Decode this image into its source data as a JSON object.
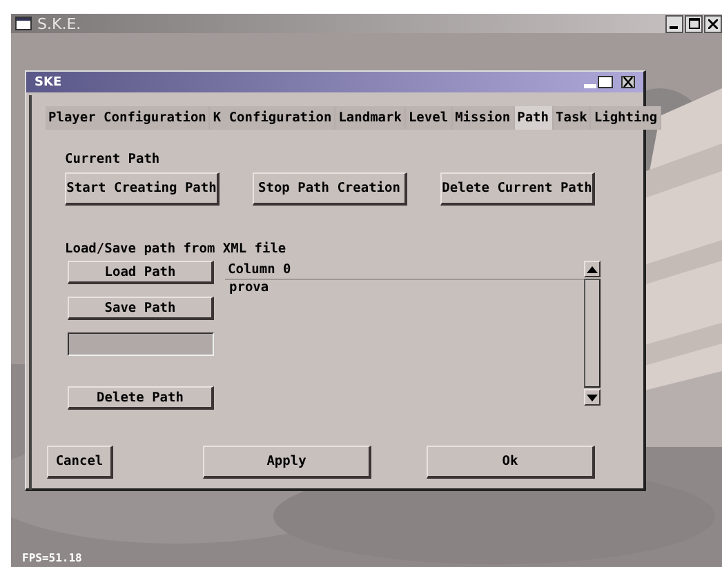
{
  "window": {
    "title": "S.K.E."
  },
  "dialog": {
    "title": "SKE",
    "tabs": [
      {
        "label": "Player Configuration",
        "selected": false
      },
      {
        "label": "K Configuration",
        "selected": false
      },
      {
        "label": "Landmark",
        "selected": false
      },
      {
        "label": "Level",
        "selected": false
      },
      {
        "label": "Mission",
        "selected": false
      },
      {
        "label": "Path",
        "selected": true
      },
      {
        "label": "Task",
        "selected": false
      },
      {
        "label": "Lighting",
        "selected": false
      }
    ],
    "current_path": {
      "label": "Current Path",
      "buttons": [
        "Start Creating Path",
        "Stop Path Creation",
        "Delete Current Path"
      ]
    },
    "file_section": {
      "label": "Load/Save path from XML file",
      "load_button": "Load Path",
      "save_button": "Save Path",
      "delete_button": "Delete Path",
      "list": {
        "columns": [
          "Column 0"
        ],
        "rows": [
          "prova"
        ]
      }
    },
    "footer_buttons": [
      "Cancel",
      "Apply",
      "Ok"
    ]
  },
  "status": "FPS=51.18"
}
